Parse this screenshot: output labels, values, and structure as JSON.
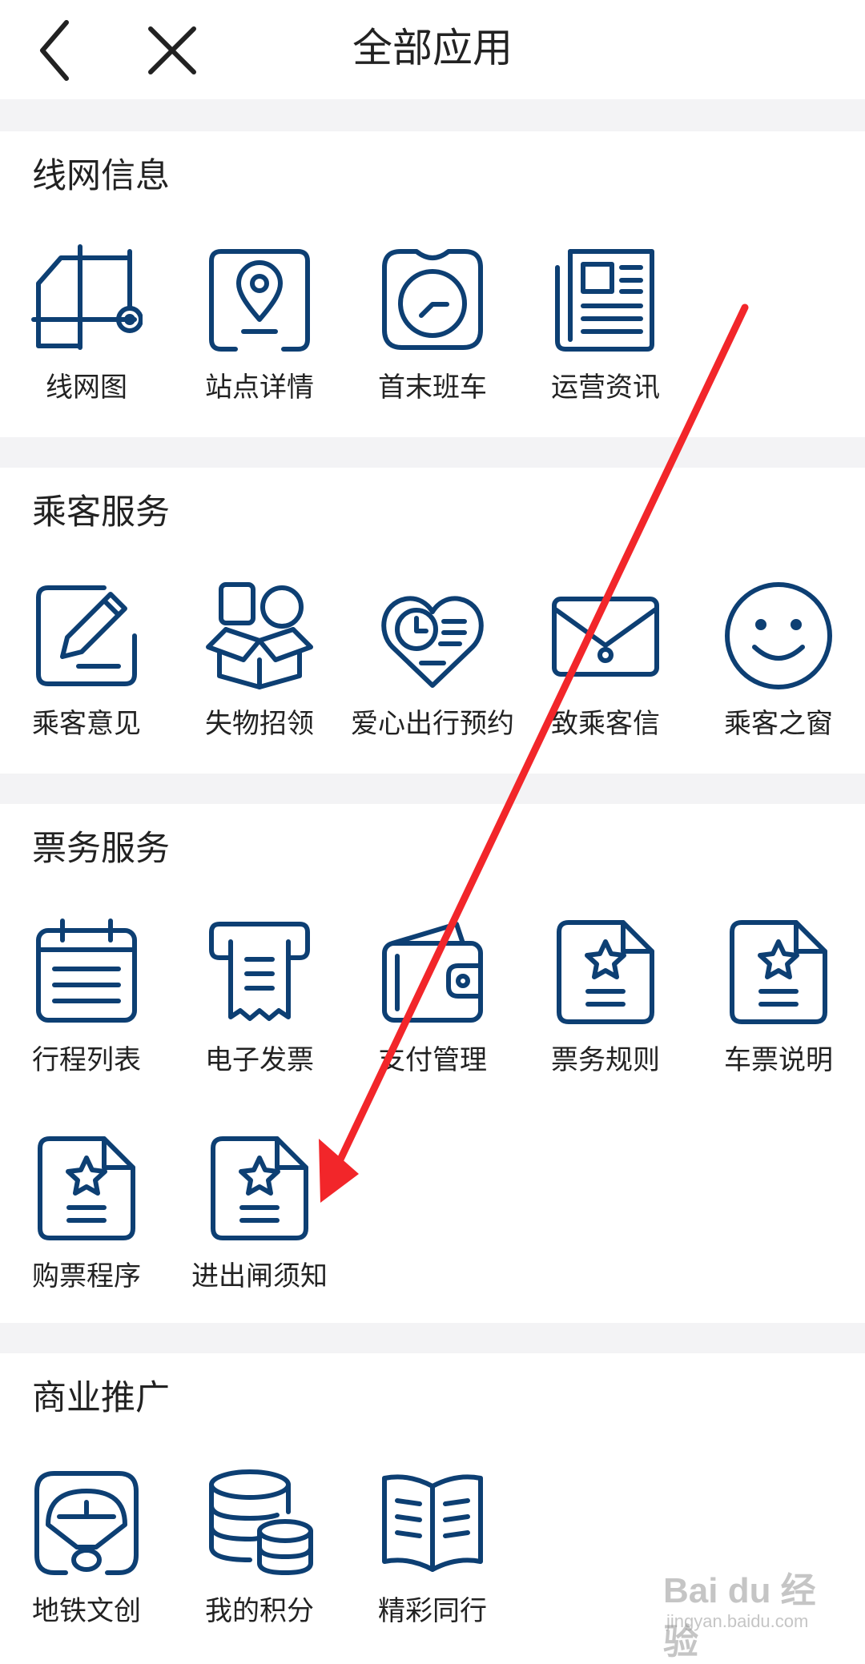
{
  "header": {
    "title": "全部应用"
  },
  "colors": {
    "icon": "#0d3f73",
    "separator": "#f3f3f5",
    "arrow": "#f2262a"
  },
  "sections": {
    "network": {
      "title": "线网信息",
      "apps": [
        {
          "label": "线网图",
          "icon": "network-map-icon"
        },
        {
          "label": "站点详情",
          "icon": "station-pin-icon"
        },
        {
          "label": "首末班车",
          "icon": "clock-icon"
        },
        {
          "label": "运营资讯",
          "icon": "newspaper-icon"
        }
      ]
    },
    "passenger": {
      "title": "乘客服务",
      "apps": [
        {
          "label": "乘客意见",
          "icon": "pencil-edit-icon"
        },
        {
          "label": "失物招领",
          "icon": "box-icon"
        },
        {
          "label": "爱心出行预约",
          "icon": "heart-clock-icon"
        },
        {
          "label": "致乘客信",
          "icon": "envelope-icon"
        },
        {
          "label": "乘客之窗",
          "icon": "smiley-icon"
        }
      ]
    },
    "ticket": {
      "title": "票务服务",
      "apps": [
        {
          "label": "行程列表",
          "icon": "calendar-list-icon"
        },
        {
          "label": "电子发票",
          "icon": "receipt-icon"
        },
        {
          "label": "支付管理",
          "icon": "wallet-icon"
        },
        {
          "label": "票务规则",
          "icon": "star-document-icon"
        },
        {
          "label": "车票说明",
          "icon": "star-document-icon"
        },
        {
          "label": "购票程序",
          "icon": "star-document-icon"
        },
        {
          "label": "进出闸须知",
          "icon": "star-document-icon"
        }
      ]
    },
    "business": {
      "title": "商业推广",
      "apps": [
        {
          "label": "地铁文创",
          "icon": "fan-icon"
        },
        {
          "label": "我的积分",
          "icon": "coin-stack-icon"
        },
        {
          "label": "精彩同行",
          "icon": "open-book-icon"
        }
      ]
    }
  },
  "watermark": {
    "brand": "Bai du 经验",
    "url": "jingyan.baidu.com"
  }
}
